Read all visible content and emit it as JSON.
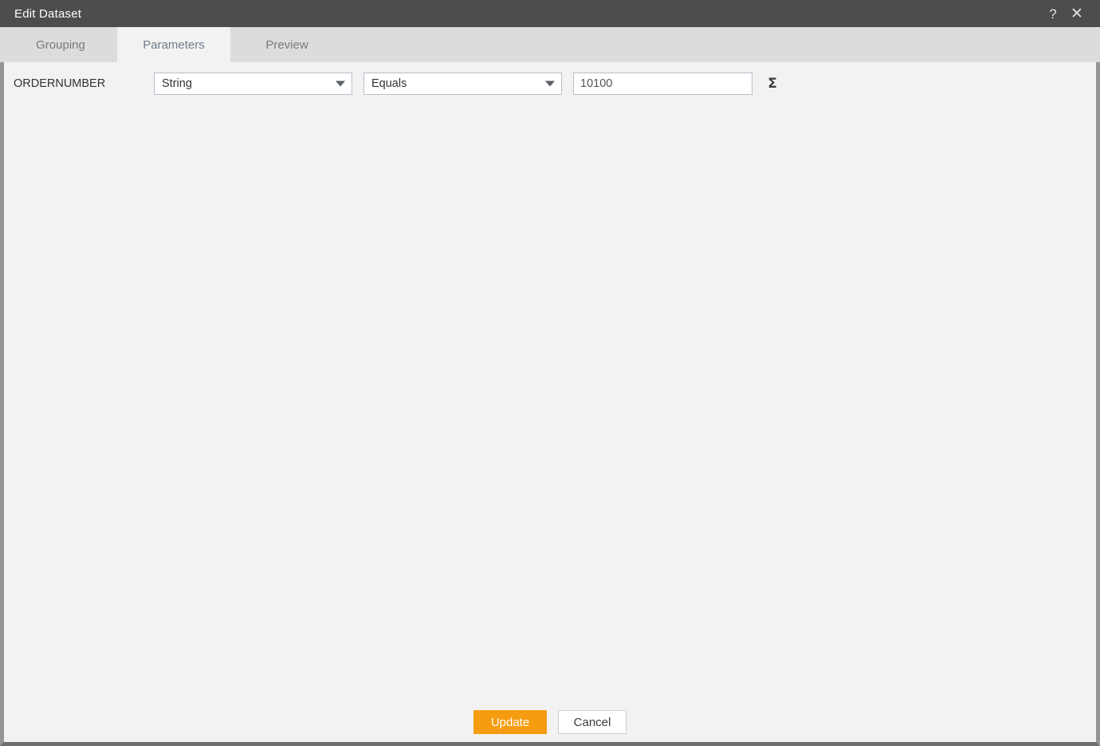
{
  "window": {
    "title": "Edit Dataset",
    "help_icon": "question-mark-icon",
    "close_icon": "close-icon",
    "help_glyph": "?",
    "close_glyph": "✕"
  },
  "tabs": [
    {
      "label": "Grouping",
      "active": false
    },
    {
      "label": "Parameters",
      "active": true
    },
    {
      "label": "Preview",
      "active": false
    }
  ],
  "parameters": [
    {
      "name": "ORDERNUMBER",
      "type": "String",
      "operator": "Equals",
      "value": "10100",
      "value_placeholder": "",
      "aggregate_icon": "sigma-icon",
      "aggregate_glyph": "Σ"
    }
  ],
  "footer": {
    "update_label": "Update",
    "cancel_label": "Cancel"
  },
  "colors": {
    "titlebar_bg": "#4d4d4d",
    "tabbar_bg": "#dcdcdc",
    "content_bg": "#f2f2f2",
    "active_tab_text": "#6f7d8c",
    "inactive_tab_text": "#7a7a7a",
    "accent_orange": "#f59c10",
    "field_border": "#b6c0cc",
    "window_border": "#949494"
  }
}
